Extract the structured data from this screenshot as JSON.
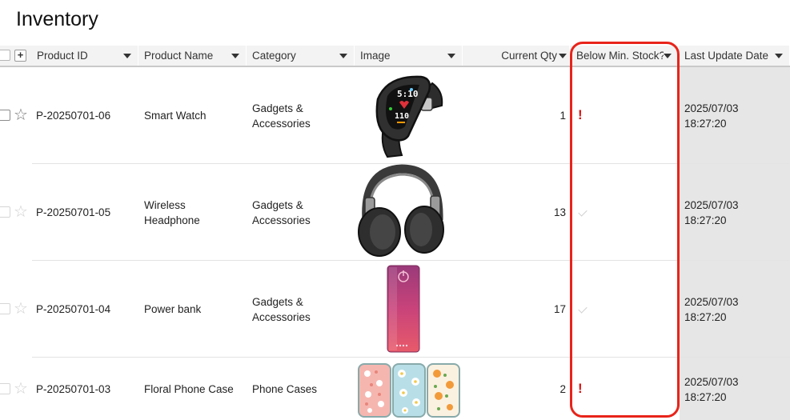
{
  "page": {
    "title": "Inventory"
  },
  "columns": [
    {
      "key": "product_id",
      "label": "Product ID"
    },
    {
      "key": "product_name",
      "label": "Product Name"
    },
    {
      "key": "category",
      "label": "Category"
    },
    {
      "key": "image",
      "label": "Image"
    },
    {
      "key": "current_qty",
      "label": "Current Qty"
    },
    {
      "key": "below_min",
      "label": "Below Min. Stock?"
    },
    {
      "key": "last_update",
      "label": "Last Update Date"
    }
  ],
  "rows": [
    {
      "product_id": "P-20250701-06",
      "product_name_1": "Smart Watch",
      "product_name_2": "",
      "category_1": "Gadgets &",
      "category_2": "Accessories",
      "image": "smart-watch",
      "current_qty": "1",
      "below_min": "!",
      "date": "2025/07/03",
      "time": "18:27:20"
    },
    {
      "product_id": "P-20250701-05",
      "product_name_1": "Wireless",
      "product_name_2": "Headphone",
      "category_1": "Gadgets &",
      "category_2": "Accessories",
      "image": "headphone",
      "current_qty": "13",
      "below_min": "check",
      "date": "2025/07/03",
      "time": "18:27:20"
    },
    {
      "product_id": "P-20250701-04",
      "product_name_1": "Power bank",
      "product_name_2": "",
      "category_1": "Gadgets &",
      "category_2": "Accessories",
      "image": "power-bank",
      "current_qty": "17",
      "below_min": "check",
      "date": "2025/07/03",
      "time": "18:27:20"
    },
    {
      "product_id": "P-20250701-03",
      "product_name_1": "Floral Phone Case",
      "product_name_2": "",
      "category_1": "Phone Cases",
      "category_2": "",
      "image": "floral-phone-case",
      "current_qty": "2",
      "below_min": "!",
      "date": "2025/07/03",
      "time": "18:27:20"
    }
  ],
  "colors": {
    "highlight": "#e8241a",
    "alert": "#d11111",
    "header_bg": "#f3f3f3",
    "last_col_bg": "#e6e6e6"
  }
}
